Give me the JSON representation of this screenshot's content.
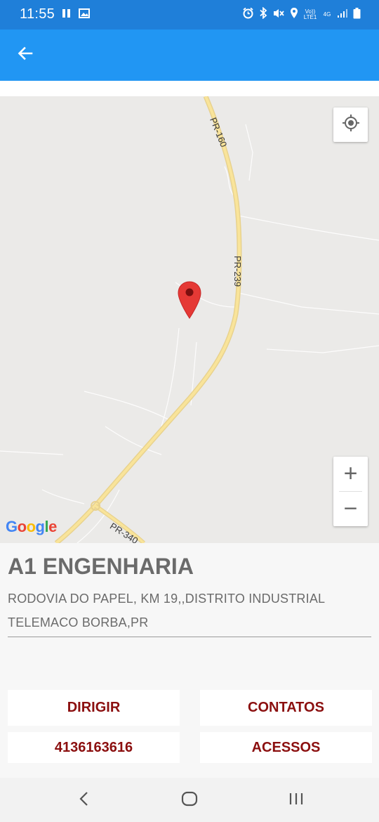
{
  "status_bar": {
    "time": "11:55",
    "volte_label": "Vo)) LTE1",
    "network_label": "4G"
  },
  "app_bar": {
    "back_icon": "arrow-left-icon"
  },
  "map": {
    "road_labels": [
      "PR-160",
      "PR-239",
      "PR-340"
    ],
    "google_logo": {
      "letters": [
        "G",
        "o",
        "o",
        "g",
        "l",
        "e"
      ],
      "colors": [
        "#4285F4",
        "#EA4335",
        "#FBBC05",
        "#4285F4",
        "#34A853",
        "#EA4335"
      ]
    },
    "zoom_in_label": "+",
    "zoom_out_label": "−",
    "pin_color": "#e53935"
  },
  "place": {
    "name": "A1 ENGENHARIA",
    "address_line1": "RODOVIA DO PAPEL, KM 19,,DISTRITO INDUSTRIAL",
    "address_line2": "TELEMACO BORBA,PR"
  },
  "actions": {
    "dirigir": "DIRIGIR",
    "contatos": "CONTATOS",
    "phone": "4136163616",
    "acessos": "ACESSOS",
    "color": "#8b0f0f"
  },
  "colors": {
    "status_bar": "#1f7fd9",
    "app_bar": "#2196f3",
    "map_background": "#ebeae8",
    "road": "#f6dd86"
  }
}
